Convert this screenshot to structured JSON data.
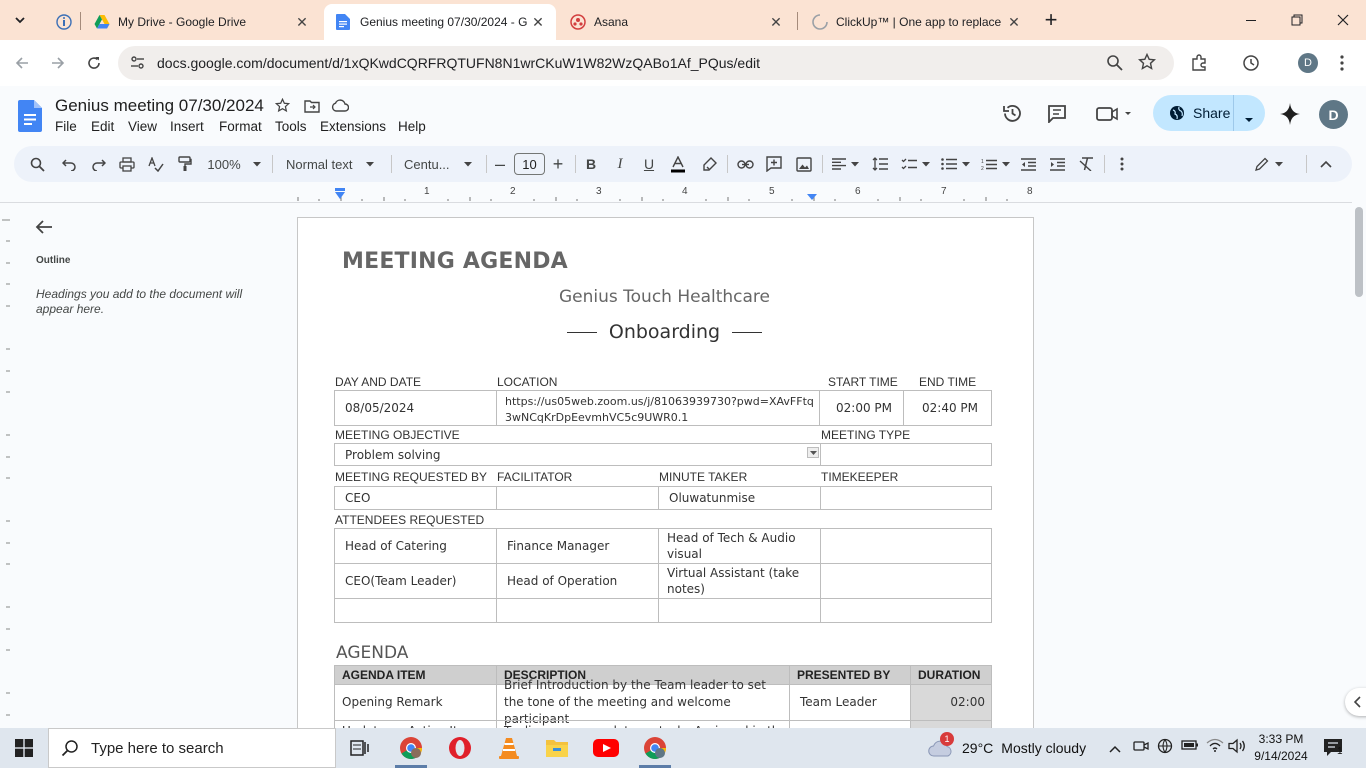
{
  "browser": {
    "tabs": [
      {
        "label": "My Drive - Google Drive",
        "icon": "google-drive-icon",
        "active": false
      },
      {
        "label": "Genius meeting 07/30/2024 - G",
        "icon": "google-docs-icon",
        "active": true
      },
      {
        "label": "Asana",
        "icon": "asana-icon",
        "active": false
      },
      {
        "label": "ClickUp™ | One app to replace t",
        "icon": "loading-icon",
        "active": false
      }
    ],
    "url": "docs.google.com/document/d/1xQKwdCQRFRQTUFN8N1wrCKuW1W82WzQABo1Af_PQus/edit",
    "profile_initial": "D"
  },
  "docs": {
    "title": "Genius meeting 07/30/2024",
    "menus": [
      "File",
      "Edit",
      "View",
      "Insert",
      "Format",
      "Tools",
      "Extensions",
      "Help"
    ],
    "share_label": "Share",
    "avatar_initial": "D",
    "toolbar": {
      "zoom": "100%",
      "style": "Normal text",
      "font": "Centu...",
      "font_size": "10"
    },
    "ruler_numbers": [
      "1",
      "2",
      "3",
      "4",
      "5",
      "6",
      "7",
      "8"
    ],
    "outline": {
      "title": "Outline",
      "hint": "Headings you add to the document will appear here."
    }
  },
  "document": {
    "heading": "MEETING AGENDA",
    "company": "Genius Touch Healthcare",
    "subtitle": "Onboarding",
    "labels": {
      "day_date": "DAY AND DATE",
      "location": "LOCATION",
      "start_time": "START TIME",
      "end_time": "END TIME",
      "objective": "MEETING OBJECTIVE",
      "meeting_type": "MEETING TYPE",
      "requested_by": "MEETING REQUESTED BY",
      "facilitator": "FACILITATOR",
      "minute_taker": "MINUTE TAKER",
      "timekeeper": "TIMEKEEPER",
      "attendees": "ATTENDEES REQUESTED"
    },
    "values": {
      "date": "08/05/2024",
      "location": "https://us05web.zoom.us/j/81063939730?pwd=XAvFFtq3wNCqKrDpEevmhVC5c9UWR0.1",
      "start_time": "02:00 PM",
      "end_time": "02:40 PM",
      "objective": "Problem solving",
      "meeting_type": "",
      "requested_by": "CEO",
      "facilitator": "",
      "minute_taker": "Oluwatunmise",
      "timekeeper": ""
    },
    "attendees": [
      [
        "Head of Catering",
        "Finance Manager",
        "Head of Tech & Audio visual",
        ""
      ],
      [
        "CEO(Team Leader)",
        "Head of Operation",
        "Virtual Assistant (take notes)",
        ""
      ],
      [
        "",
        "",
        "",
        ""
      ]
    ],
    "agenda_heading": "AGENDA",
    "agenda_columns": [
      "AGENDA ITEM",
      "DESCRIPTION",
      "PRESENTED BY",
      "DURATION"
    ],
    "agenda_rows": [
      {
        "item": "Opening Remark",
        "description": "Brief Introduction by the Team leader to set the tone of the meeting and welcome participant",
        "presenter": "Team Leader",
        "duration": "02:00"
      },
      {
        "item": "Update on Action Items",
        "description": "To discuss any update on tasks Assigned in the",
        "presenter": "",
        "duration": ""
      }
    ]
  },
  "taskbar": {
    "search_placeholder": "Type here to search",
    "weather_temp": "29°C",
    "weather_text": "Mostly cloudy",
    "weather_badge": "1",
    "time": "3:33 PM",
    "date": "9/14/2024",
    "notification_count": "1"
  }
}
